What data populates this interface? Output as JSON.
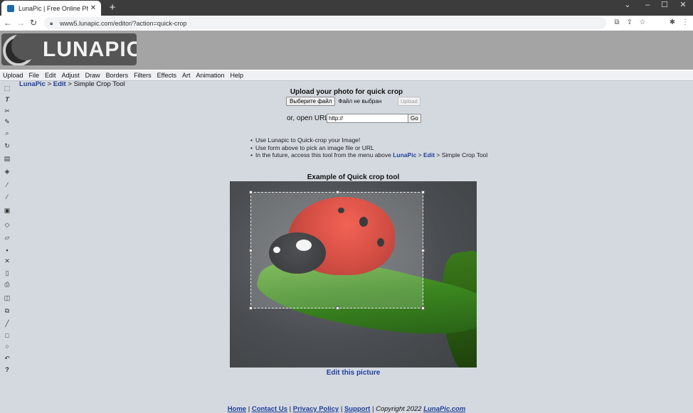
{
  "browser": {
    "tab_title": "LunaPic | Free Online Photo Editi",
    "tab_close": "✕",
    "new_tab": "+",
    "url": "www5.lunapic.com/editor/?action=quick-crop",
    "window_controls": [
      "⌄",
      "–",
      "☐",
      "✕"
    ]
  },
  "site": {
    "logo_text": "LUNAPIC"
  },
  "menu": [
    "Upload",
    "File",
    "Edit",
    "Adjust",
    "Draw",
    "Borders",
    "Filters",
    "Effects",
    "Art",
    "Animation",
    "Help"
  ],
  "breadcrumb": {
    "home": "LunaPic",
    "sep1": " > ",
    "edit": "Edit",
    "sep2": " > ",
    "current": "Simple Crop Tool"
  },
  "upload": {
    "title": "Upload your photo for quick crop",
    "choose_button": "Выберите файл",
    "no_file": "Файл не выбран",
    "upload_button": "Upload",
    "url_label": "or, open URL",
    "url_value": "http://",
    "go_button": "Go"
  },
  "tips": {
    "line1": "Use Lunapic to Quick-crop your Image!",
    "line2": "Use form above to pick an image file or URL",
    "line3_prefix": "In the future, access this tool from the menu above ",
    "line3_link1": "LunaPic",
    "line3_sep1": " > ",
    "line3_link2": "Edit",
    "line3_suffix": " > Simple Crop Tool"
  },
  "example": {
    "title": "Example of Quick crop tool",
    "edit_link": "Edit this picture"
  },
  "footer": {
    "home": "Home",
    "contact": "Contact Us",
    "privacy": "Privacy Policy",
    "support": "Support",
    "sep": " | ",
    "copyright_prefix": "Copyright 2022 ",
    "copyright_link": "LunaPic.com"
  },
  "sidebar_tools": [
    {
      "icon": "selection-icon",
      "glyph": "⬚"
    },
    {
      "icon": "text-icon",
      "glyph": "T"
    },
    {
      "icon": "scissors-icon",
      "glyph": "✂"
    },
    {
      "icon": "pencil-icon",
      "glyph": "✎"
    },
    {
      "icon": "zoom-icon",
      "glyph": "⌕"
    },
    {
      "icon": "rotate-icon",
      "glyph": "↻"
    },
    {
      "icon": "gradient-icon",
      "glyph": "▤"
    },
    {
      "icon": "bucket-icon",
      "glyph": "◈"
    },
    {
      "icon": "eyedropper-icon",
      "glyph": "⁄"
    },
    {
      "icon": "brush-icon",
      "glyph": "⁄"
    },
    {
      "icon": "image-icon",
      "glyph": "▣"
    },
    {
      "icon": "eraser-icon",
      "glyph": "◇"
    },
    {
      "icon": "open-folder-icon",
      "glyph": "▱"
    },
    {
      "icon": "save-icon",
      "glyph": "▪"
    },
    {
      "icon": "delete-icon",
      "glyph": "✕"
    },
    {
      "icon": "new-page-icon",
      "glyph": "▯"
    },
    {
      "icon": "print-icon",
      "glyph": "⎙"
    },
    {
      "icon": "layers-icon",
      "glyph": "◫"
    },
    {
      "icon": "copy-icon",
      "glyph": "⧉"
    },
    {
      "icon": "line-icon",
      "glyph": "╱"
    },
    {
      "icon": "rectangle-icon",
      "glyph": "□"
    },
    {
      "icon": "circle-icon",
      "glyph": "○"
    },
    {
      "icon": "undo-icon",
      "glyph": "↶"
    },
    {
      "icon": "help-icon",
      "glyph": "?"
    }
  ],
  "toolbar_icons": {
    "translate": "⧉",
    "share": "⇪",
    "bookmark": "☆",
    "extensions": "✱",
    "menu": "⋮"
  }
}
